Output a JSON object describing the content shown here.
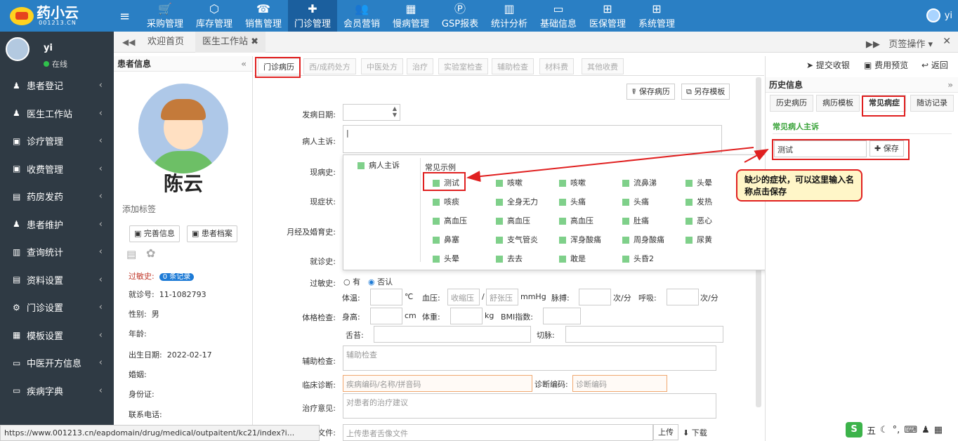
{
  "app": {
    "logo": "药小云",
    "logo_sub": "001213.CN"
  },
  "topnav": {
    "items": [
      "采购管理",
      "库存管理",
      "销售管理",
      "门诊管理",
      "会员营销",
      "慢病管理",
      "GSP报表",
      "统计分析",
      "基础信息",
      "医保管理",
      "系统管理"
    ],
    "icons": [
      "cart-icon",
      "box-icon",
      "phone-icon",
      "medkit-icon",
      "users-icon",
      "calculator-icon",
      "gsp-icon",
      "bar-chart-icon",
      "book-icon",
      "windows-icon",
      "windows-icon"
    ],
    "active_index": 3,
    "user": "yi"
  },
  "sidebar": {
    "user": "yi",
    "status": "在线",
    "items": [
      "患者登记",
      "医生工作站",
      "诊疗管理",
      "收费管理",
      "药房发药",
      "患者维护",
      "查询统计",
      "资料设置",
      "门诊设置",
      "模板设置",
      "中医开方信息",
      "疾病字典"
    ]
  },
  "tabs": {
    "home": "欢迎首页",
    "doctor": "医生工作站",
    "page_ops": "页签操作"
  },
  "patient": {
    "panel_title": "患者信息",
    "name": "陈云",
    "add_tag": "添加标签",
    "btn_complete": "完善信息",
    "btn_archive": "患者档案",
    "allergy_label": "过敏史:",
    "allergy_badge": "0 条记录",
    "visit_label": "就诊号:",
    "visit_no": "11-1082793",
    "gender_label": "性别:",
    "gender": "男",
    "age_label": "年龄:",
    "birth_label": "出生日期:",
    "birth": "2022-02-17",
    "marriage_label": "婚姻:",
    "id_label": "身份证:",
    "phone_label": "联系电话:"
  },
  "subtabs": [
    "门诊病历",
    "西/成药处方",
    "中医处方",
    "治疗",
    "实验室检查",
    "辅助检查",
    "材料费",
    "其他收费"
  ],
  "actions": {
    "submit": "提交收银",
    "preview": "费用预览",
    "back": "返回",
    "save_record": "保存病历",
    "save_template": "另存模板"
  },
  "form": {
    "onset": "发病日期:",
    "complaint": "病人主诉:",
    "history": "现病史:",
    "symptom": "现症状:",
    "menstrual": "月经及婚育史:",
    "prior": "就诊史:",
    "allergy": "过敏史:",
    "allergy_yes": "有",
    "allergy_no": "否认",
    "exam": "体格检查:",
    "temp": "体温:",
    "temp_unit": "℃",
    "bp": "血压:",
    "bp_sys": "收缩压",
    "bp_dia": "舒张压",
    "bp_unit": "mmHg",
    "pulse": "脉搏:",
    "per_min": "次/分",
    "resp": "呼吸:",
    "height": "身高:",
    "height_unit": "cm",
    "weight": "体重:",
    "weight_unit": "kg",
    "bmi": "BMI指数:",
    "tongue": "舌苔:",
    "pulse_cut": "切脉:",
    "aux": "辅助检查:",
    "aux_ph": "辅助检查",
    "diag": "临床诊断:",
    "diag_ph": "疾病编码/名称/拼音码",
    "diag_code": "诊断编码:",
    "diag_code_ph": "诊断编码",
    "treatment": "治疗意见:",
    "treatment_ph": "对患者的治疗建议",
    "file": "文件:",
    "file_ph": "上传患者舌像文件",
    "upload": "上传",
    "download": "下载"
  },
  "popup": {
    "left_item": "病人主诉",
    "header": "常见示例",
    "options": [
      [
        "测试",
        "咳嗽",
        "咳嗽",
        "流鼻涕",
        "头晕"
      ],
      [
        "咳痰",
        "全身无力",
        "头痛",
        "头痛",
        "发热"
      ],
      [
        "高血压",
        "高血压",
        "高血压",
        "肚痛",
        "恶心"
      ],
      [
        "鼻塞",
        "支气管炎",
        "浑身酸痛",
        "周身酸痛",
        "尿黄"
      ],
      [
        "头晕",
        "去去",
        "敢是",
        "头昏2",
        ""
      ]
    ]
  },
  "history": {
    "title": "历史信息",
    "tabs": [
      "历史病历",
      "病历模板",
      "常见病症",
      "随访记录"
    ],
    "active_tab": 2,
    "section": "常见病人主诉",
    "input_value": "测试",
    "save": "保存"
  },
  "callout": "缺少的症状，可以这里输入名称点击保存",
  "status_url": "https://www.001213.cn/eapdomain/drug/medical/outpaitent/kc21/index?i...",
  "ime": {
    "label": "五"
  },
  "colors": {
    "topbar": "#2a7fc4",
    "sidebar": "#2f3a44",
    "annot_red": "#e02020",
    "check_green": "#7fd08a"
  }
}
